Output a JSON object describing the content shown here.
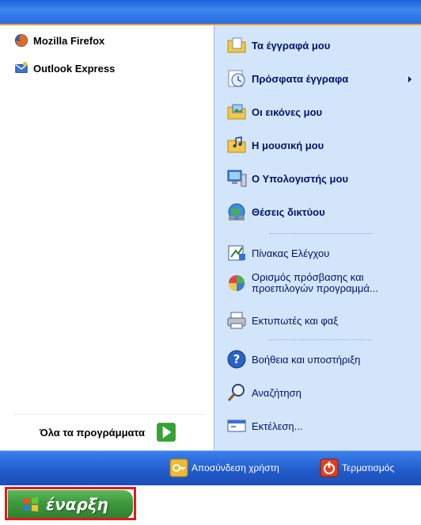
{
  "left_pinned": [
    {
      "label": "Mozilla Firefox",
      "icon": "firefox-icon"
    },
    {
      "label": "Outlook Express",
      "icon": "outlook-express-icon"
    }
  ],
  "all_programs": {
    "label": "Όλα τα προγράμματα",
    "icon": "green-arrow-icon"
  },
  "right_items": [
    {
      "label": "Τα έγγραφά μου",
      "icon": "my-documents-icon"
    },
    {
      "label": "Πρόσφατα έγγραφα",
      "icon": "recent-documents-icon"
    },
    {
      "label": "Οι εικόνες μου",
      "icon": "my-pictures-icon"
    },
    {
      "label": "Η μουσική μου",
      "icon": "my-music-icon"
    },
    {
      "label": "Ο Υπολογιστής μου",
      "icon": "my-computer-icon"
    },
    {
      "label": "Θέσεις δικτύου",
      "icon": "network-places-icon"
    },
    {
      "label": "Πίνακας Ελέγχου",
      "icon": "control-panel-icon"
    },
    {
      "label": "Ορισμός πρόσβασης και προεπιλογών προγραμμά...",
      "icon": "program-access-icon"
    },
    {
      "label": "Εκτυπωτές και φαξ",
      "icon": "printer-icon"
    },
    {
      "label": "Βοήθεια και υποστήριξη",
      "icon": "help-icon"
    },
    {
      "label": "Αναζήτηση",
      "icon": "search-icon"
    },
    {
      "label": "Εκτέλεση...",
      "icon": "run-icon"
    }
  ],
  "bottom_bar": {
    "logoff_label": "Αποσύνδεση χρήστη",
    "shutdown_label": "Τερματισμός"
  },
  "start_button": {
    "label": "έναρξη"
  },
  "colors": {
    "accent_blue": "#2a6be0",
    "right_panel_bg": "#d3e5fa",
    "start_green": "#3c9a3c",
    "highlight_red": "#e11b1b"
  }
}
